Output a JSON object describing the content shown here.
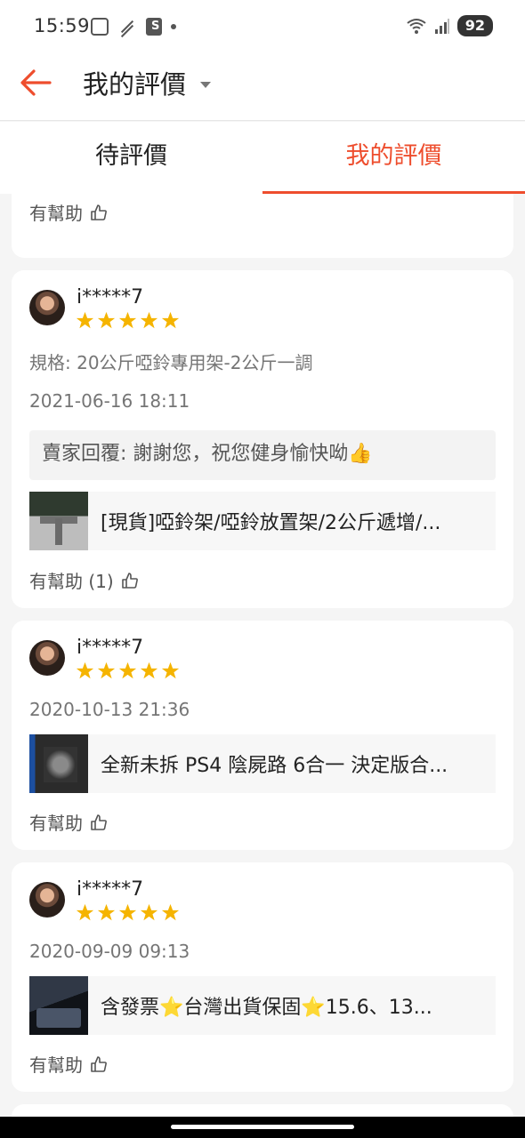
{
  "status_bar": {
    "time": "15:59",
    "battery": "92",
    "icons": [
      "screenshot-icon",
      "no-signal-icon",
      "shopee-icon",
      "dot-icon",
      "wifi-icon",
      "signal-icon"
    ]
  },
  "header": {
    "title": "我的評價",
    "back_icon": "back-arrow-icon",
    "dropdown_icon": "caret-down-icon"
  },
  "tabs": [
    {
      "label": "待評價",
      "active": false
    },
    {
      "label": "我的評價",
      "active": true
    }
  ],
  "colors": {
    "accent": "#ee4d2d",
    "star": "#f5b400"
  },
  "partial_card": {
    "helpful_label": "有幫助"
  },
  "reviews": [
    {
      "username": "i*****7",
      "rating": 5,
      "spec": "規格: 20公斤啞鈴專用架-2公斤一調",
      "date": "2021-06-16 18:11",
      "seller_reply": "賣家回覆: 謝謝您，祝您健身愉快呦👍",
      "product_name": "[現貨]啞鈴架/啞鈴放置架/2公斤遞增/...",
      "helpful_label": "有幫助 (1)"
    },
    {
      "username": "i*****7",
      "rating": 5,
      "date": "2020-10-13 21:36",
      "product_name": "全新未拆 PS4 陰屍路 6合一 決定版合...",
      "helpful_label": "有幫助"
    },
    {
      "username": "i*****7",
      "rating": 5,
      "date": "2020-09-09 09:13",
      "product_name": "含發票⭐台灣出貨保固⭐15.6、13...",
      "helpful_label": "有幫助"
    }
  ]
}
